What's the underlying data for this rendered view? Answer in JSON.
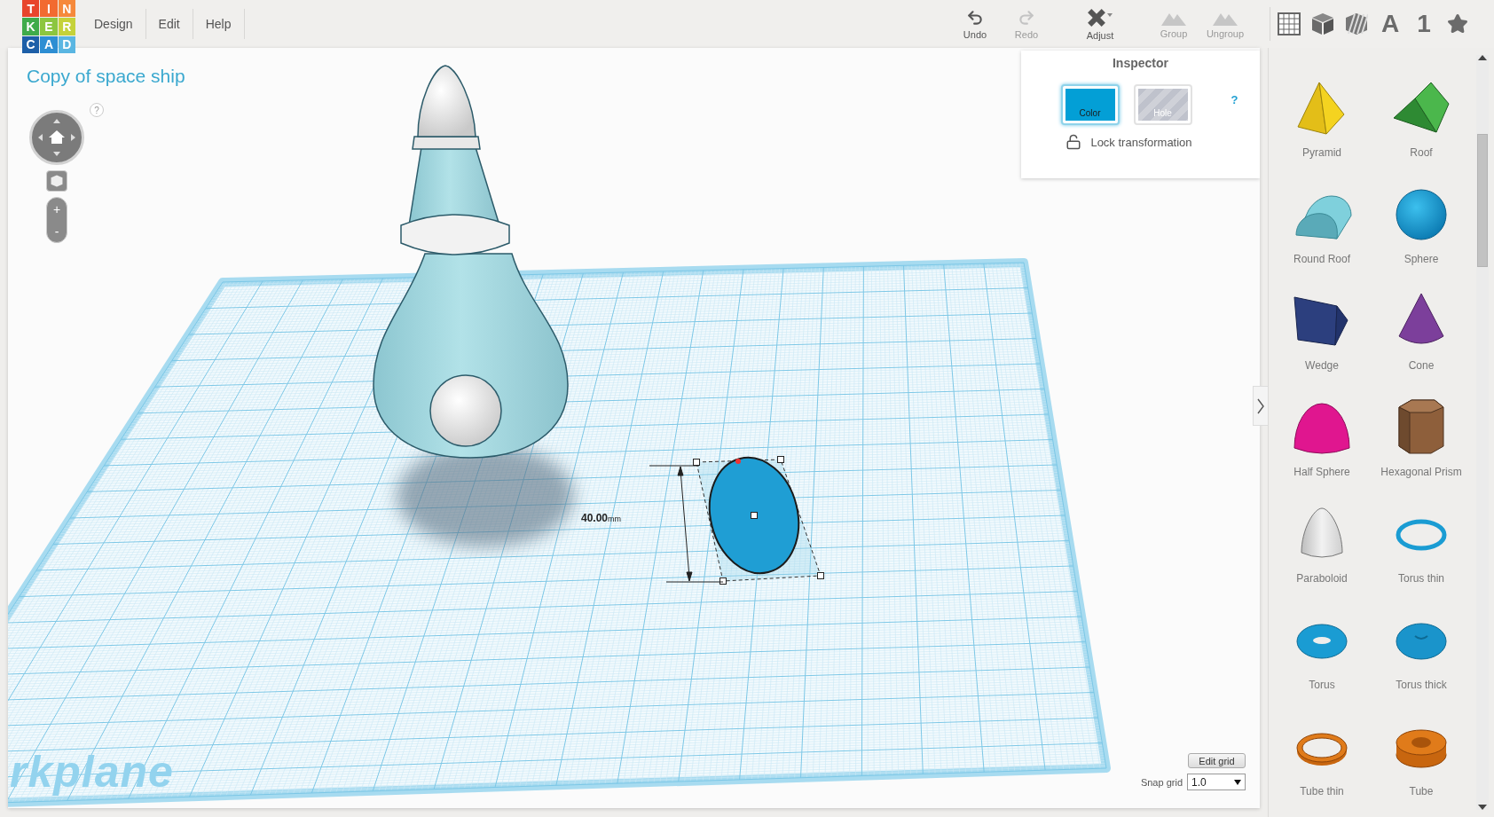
{
  "logo": {
    "letters": [
      {
        "char": "T",
        "color": "#e8452c"
      },
      {
        "char": "I",
        "color": "#f26a30"
      },
      {
        "char": "N",
        "color": "#f6893b"
      },
      {
        "char": "K",
        "color": "#3fab4a"
      },
      {
        "char": "E",
        "color": "#8cc63f"
      },
      {
        "char": "R",
        "color": "#c5d23a"
      },
      {
        "char": "C",
        "color": "#1d5fa8"
      },
      {
        "char": "A",
        "color": "#2d8ed3"
      },
      {
        "char": "D",
        "color": "#5ab6e2"
      }
    ]
  },
  "menu": [
    "Design",
    "Edit",
    "Help"
  ],
  "toolbar": [
    {
      "kind": "undo",
      "label": "Undo",
      "disabled": false
    },
    {
      "kind": "redo",
      "label": "Redo",
      "disabled": true
    },
    {
      "kind": "adjust",
      "label": "Adjust",
      "disabled": false
    },
    {
      "kind": "group",
      "label": "Group",
      "disabled": true
    },
    {
      "kind": "ungroup",
      "label": "Ungroup",
      "disabled": true
    }
  ],
  "library_tabs": [
    {
      "kind": "grid"
    },
    {
      "kind": "box"
    },
    {
      "kind": "hole-box"
    },
    {
      "kind": "text",
      "label": "A"
    },
    {
      "kind": "text",
      "label": "1"
    },
    {
      "kind": "star"
    }
  ],
  "design": {
    "title": "Copy of space ship",
    "help": "?",
    "zoom_in": "+",
    "zoom_out": "-",
    "workplane_label": "rkplane",
    "dimension": "**40.00**mm"
  },
  "inspector": {
    "title": "Inspector",
    "help": "?",
    "modes": [
      {
        "kind": "color",
        "label": "Color",
        "selected": true
      },
      {
        "kind": "hole",
        "label": "Hole",
        "selected": false
      }
    ],
    "lock": {
      "label": "Lock transformation",
      "locked": false
    }
  },
  "grid_controls": {
    "edit_label": "Edit grid",
    "snap_label": "Snap grid",
    "snap_value": "1.0"
  },
  "shapes": [
    {
      "kind": "pyramid",
      "label": "Pyramid"
    },
    {
      "kind": "roof",
      "label": "Roof"
    },
    {
      "kind": "round-roof",
      "label": "Round Roof"
    },
    {
      "kind": "sphere",
      "label": "Sphere"
    },
    {
      "kind": "wedge",
      "label": "Wedge"
    },
    {
      "kind": "cone",
      "label": "Cone"
    },
    {
      "kind": "half-sphere",
      "label": "Half Sphere"
    },
    {
      "kind": "hex-prism",
      "label": "Hexagonal Prism"
    },
    {
      "kind": "paraboloid",
      "label": "Paraboloid"
    },
    {
      "kind": "torus-thin",
      "label": "Torus thin"
    },
    {
      "kind": "torus",
      "label": "Torus"
    },
    {
      "kind": "torus-thick",
      "label": "Torus thick"
    },
    {
      "kind": "tube-thin",
      "label": "Tube thin"
    },
    {
      "kind": "tube",
      "label": "Tube"
    }
  ]
}
